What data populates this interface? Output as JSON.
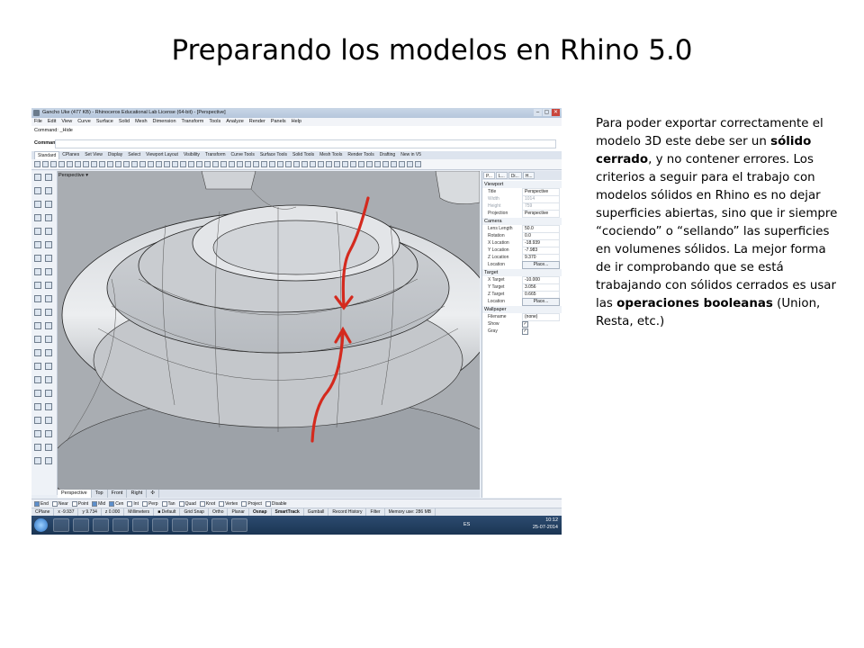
{
  "slide": {
    "title": "Preparando los modelos en Rhino 5.0",
    "paragraph": [
      {
        "text": "Para poder exportar correctamente el modelo 3D este debe ser un ",
        "bold": false
      },
      {
        "text": "sólido cerrado",
        "bold": true
      },
      {
        "text": ", y no contener errores. Los criterios a seguir para el trabajo con modelos sólidos en Rhino es no dejar superficies abiertas, sino que ir siempre “cociendo” o “sellando” las superficies en volumenes sólidos.  La mejor forma de ir comprobando que se está trabajando con sólidos cerrados es usar las ",
        "bold": false
      },
      {
        "text": "operaciones booleanas",
        "bold": true
      },
      {
        "text": " (Union, Resta, etc.)",
        "bold": false
      }
    ]
  },
  "window": {
    "title": "Gancho Uke (477 KB) - Rhinoceros Educational Lab License (64-bit) - [Perspective]",
    "controls": [
      "–",
      "▢",
      "✕"
    ]
  },
  "menu": [
    "File",
    "Edit",
    "View",
    "Curve",
    "Surface",
    "Solid",
    "Mesh",
    "Dimension",
    "Transform",
    "Tools",
    "Analyze",
    "Render",
    "Panels",
    "Help"
  ],
  "command": {
    "history_label": "Command:",
    "history_value": "_Hide",
    "prompt_label": "Command:"
  },
  "toolbar_tabs": [
    "Standard",
    "CPlanes",
    "Set View",
    "Display",
    "Select",
    "Viewport Layout",
    "Visibility",
    "Transform",
    "Curve Tools",
    "Surface Tools",
    "Solid Tools",
    "Mesh Tools",
    "Render Tools",
    "Drafting",
    "New in V5"
  ],
  "active_toolbar_tab": "Standard",
  "viewport": {
    "label": "Perspective",
    "tabs": [
      "Perspective",
      "Top",
      "Front",
      "Right",
      "✣"
    ],
    "arrow_color": "#d42a1e"
  },
  "panel": {
    "tabs": [
      "P...",
      "L...",
      "Di...",
      "H..."
    ],
    "sections": [
      {
        "name": "Viewport",
        "rows": [
          {
            "key": "Title",
            "value": "Perspective",
            "grey": false
          },
          {
            "key": "Width",
            "value": "1014",
            "grey": true
          },
          {
            "key": "Height",
            "value": "759",
            "grey": true
          },
          {
            "key": "Projection",
            "value": "Perspective",
            "grey": false
          }
        ]
      },
      {
        "name": "Camera",
        "rows": [
          {
            "key": "Lens Length",
            "value": "50.0",
            "grey": false
          },
          {
            "key": "Rotation",
            "value": "0.0",
            "grey": false
          },
          {
            "key": "X Location",
            "value": "-18.939",
            "grey": false
          },
          {
            "key": "Y Location",
            "value": "-7.983",
            "grey": false
          },
          {
            "key": "Z Location",
            "value": "9.370",
            "grey": false
          },
          {
            "key": "Location",
            "button": "Place...",
            "grey": false
          }
        ]
      },
      {
        "name": "Target",
        "rows": [
          {
            "key": "X Target",
            "value": "-10.000",
            "grey": false
          },
          {
            "key": "Y Target",
            "value": "3.056",
            "grey": false
          },
          {
            "key": "Z Target",
            "value": "0.665",
            "grey": false
          },
          {
            "key": "Location",
            "button": "Place...",
            "grey": false
          }
        ]
      },
      {
        "name": "Wallpaper",
        "rows": [
          {
            "key": "Filename",
            "value": "(none)",
            "grey": false
          },
          {
            "key": "Show",
            "check": "✓",
            "grey": false
          },
          {
            "key": "Gray",
            "check": "✓",
            "grey": false
          }
        ]
      }
    ]
  },
  "osnap": [
    {
      "label": "End",
      "on": true
    },
    {
      "label": "Near",
      "on": false
    },
    {
      "label": "Point",
      "on": false
    },
    {
      "label": "Mid",
      "on": true
    },
    {
      "label": "Cen",
      "on": true
    },
    {
      "label": "Int",
      "on": false
    },
    {
      "label": "Perp",
      "on": false
    },
    {
      "label": "Tan",
      "on": false
    },
    {
      "label": "Quad",
      "on": false
    },
    {
      "label": "Knot",
      "on": false
    },
    {
      "label": "Vertex",
      "on": false
    },
    {
      "label": "Project",
      "on": false
    },
    {
      "label": "Disable",
      "on": false
    }
  ],
  "statusbar": [
    {
      "text": "CPlane",
      "bold": false
    },
    {
      "text": "x -9.937",
      "bold": false
    },
    {
      "text": "y 9.734",
      "bold": false
    },
    {
      "text": "z 0.000",
      "bold": false
    },
    {
      "text": "Millimeters",
      "bold": false
    },
    {
      "text": "■ Default",
      "bold": false
    },
    {
      "text": "Grid Snap",
      "bold": false
    },
    {
      "text": "Ortho",
      "bold": false
    },
    {
      "text": "Planar",
      "bold": false
    },
    {
      "text": "Osnap",
      "bold": true
    },
    {
      "text": "SmartTrack",
      "bold": true
    },
    {
      "text": "Gumball",
      "bold": false
    },
    {
      "text": "Record History",
      "bold": false
    },
    {
      "text": "Filter",
      "bold": false
    },
    {
      "text": "Memory use: 286 MB",
      "bold": false
    }
  ],
  "taskbar": {
    "language": "ES",
    "time": "10:12",
    "date": "25-07-2014"
  }
}
